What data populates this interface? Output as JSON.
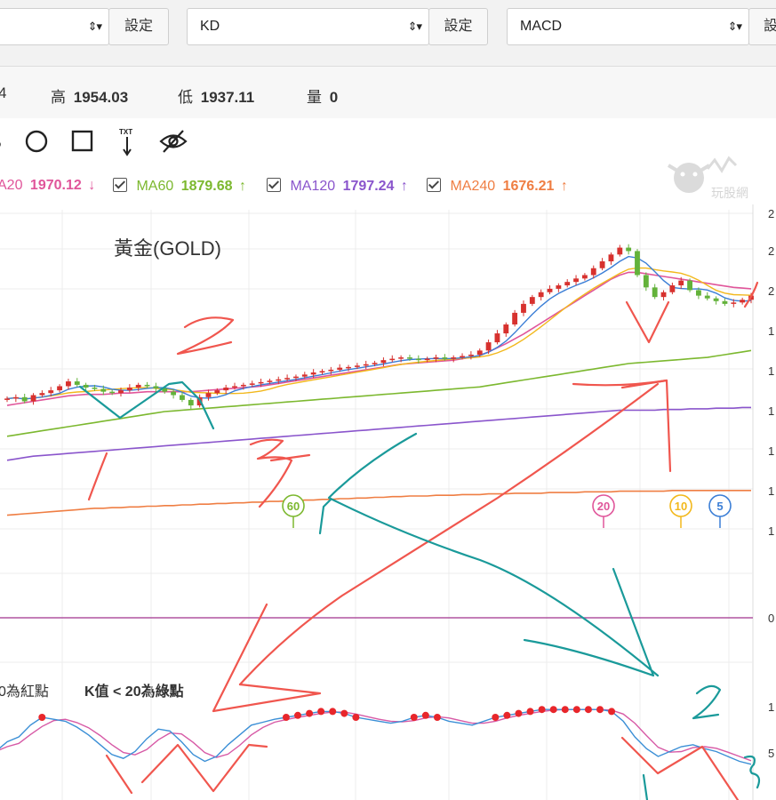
{
  "toolbar": {
    "select1_label": "",
    "set1_label": "設定",
    "select2_label": "KD",
    "set2_label": "設定",
    "select3_label": "MACD",
    "set3_label": "設",
    "arrows": "⇕▾"
  },
  "price_info": {
    "open_partial": "4",
    "high_label": "高",
    "high_value": "1954.03",
    "low_label": "低",
    "low_value": "1937.11",
    "volume_label": "量",
    "volume_value": "0"
  },
  "tools": {
    "items": [
      "candle-tool-icon",
      "circle-tool-icon",
      "rectangle-tool-icon",
      "text-tool-icon",
      "hide-drawings-icon"
    ],
    "text_tool_label": "TXT"
  },
  "ma_legend": [
    {
      "label": "A20",
      "value": "1970.12",
      "arrow": "↓",
      "color": "#e0559a"
    },
    {
      "label": "MA60",
      "value": "1879.68",
      "arrow": "↑",
      "color": "#7cb82f"
    },
    {
      "label": "MA120",
      "value": "1797.24",
      "arrow": "↑",
      "color": "#8a55cc"
    },
    {
      "label": "MA240",
      "value": "1676.21",
      "arrow": "↑",
      "color": "#ef7e43"
    }
  ],
  "watermark": "玩股網",
  "kd_note": {
    "left": "0為紅點",
    "right": "K值 < 20為綠點"
  },
  "colors": {
    "up_candle": "#d7312e",
    "down_candle": "#63b23a",
    "ma5": "#3b7ed6",
    "ma10": "#f2b81c",
    "ma20": "#e0559a",
    "ma60": "#7cb82f",
    "ma120": "#8a55cc",
    "ma240": "#ef7e43",
    "macd_zero": "#b054a0",
    "kd_k": "#3b8fd6",
    "kd_d": "#d75aa6",
    "kd_dot": "#e8262b",
    "annotation_red": "#f0564e",
    "annotation_teal": "#1a9a9a"
  },
  "chart_data": {
    "type": "line",
    "title": "黃金(GOLD)",
    "y_tick_labels_partial": [
      "2",
      "2",
      "2",
      "1",
      "1",
      "1",
      "1",
      "1",
      "1"
    ],
    "macd_zero_label": "0",
    "kd_tick_labels_partial": [
      "1",
      "5"
    ],
    "period_markers": [
      {
        "label": "60",
        "color": "#7cb82f"
      },
      {
        "label": "20",
        "color": "#e0559a"
      },
      {
        "label": "10",
        "color": "#f2b81c"
      },
      {
        "label": "5",
        "color": "#3b7ed6"
      }
    ],
    "approx_price_range": [
      1620,
      2080
    ],
    "close_prices": [
      1810,
      1812,
      1806,
      1815,
      1818,
      1822,
      1828,
      1835,
      1830,
      1826,
      1824,
      1820,
      1818,
      1822,
      1826,
      1830,
      1828,
      1825,
      1820,
      1815,
      1808,
      1800,
      1812,
      1818,
      1822,
      1826,
      1828,
      1830,
      1832,
      1834,
      1836,
      1838,
      1840,
      1842,
      1845,
      1848,
      1850,
      1852,
      1855,
      1856,
      1858,
      1860,
      1862,
      1866,
      1868,
      1870,
      1868,
      1866,
      1868,
      1870,
      1868,
      1870,
      1872,
      1874,
      1880,
      1892,
      1905,
      1918,
      1935,
      1948,
      1958,
      1965,
      1970,
      1975,
      1980,
      1985,
      1990,
      2000,
      2010,
      2020,
      2030,
      2025,
      1990,
      1972,
      1958,
      1965,
      1975,
      1982,
      1968,
      1960,
      1956,
      1952,
      1948,
      1950,
      1954,
      1960
    ],
    "series": [
      {
        "name": "MA20",
        "values": [
          1800,
          1802,
          1804,
          1806,
          1808,
          1810,
          1812,
          1814,
          1815,
          1816,
          1816,
          1816,
          1817,
          1818,
          1818,
          1819,
          1820,
          1820,
          1820,
          1820,
          1820,
          1820,
          1821,
          1822,
          1823,
          1824,
          1825,
          1826,
          1827,
          1828,
          1830,
          1832,
          1834,
          1836,
          1838,
          1840,
          1842,
          1844,
          1846,
          1848,
          1850,
          1852,
          1854,
          1856,
          1858,
          1860,
          1861,
          1862,
          1863,
          1864,
          1865,
          1866,
          1868,
          1870,
          1873,
          1878,
          1884,
          1890,
          1897,
          1904,
          1912,
          1920,
          1928,
          1936,
          1944,
          1952,
          1960,
          1968,
          1976,
          1984,
          1990,
          1994,
          1994,
          1992,
          1990,
          1988,
          1986,
          1984,
          1982,
          1980,
          1978,
          1976,
          1974,
          1972,
          1971,
          1970
        ]
      },
      {
        "name": "MA60",
        "values": [
          1755,
          1757,
          1759,
          1761,
          1763,
          1765,
          1767,
          1769,
          1771,
          1773,
          1775,
          1777,
          1779,
          1781,
          1783,
          1785,
          1787,
          1789,
          1791,
          1792,
          1793,
          1794,
          1795,
          1796,
          1797,
          1798,
          1799,
          1800,
          1801,
          1802,
          1803,
          1804,
          1805,
          1806,
          1807,
          1808,
          1809,
          1810,
          1811,
          1812,
          1813,
          1814,
          1815,
          1816,
          1817,
          1818,
          1819,
          1820,
          1821,
          1822,
          1823,
          1824,
          1825,
          1826,
          1827,
          1829,
          1831,
          1833,
          1835,
          1837,
          1839,
          1841,
          1843,
          1845,
          1847,
          1849,
          1851,
          1853,
          1855,
          1857,
          1859,
          1861,
          1862,
          1863,
          1864,
          1865,
          1866,
          1867,
          1868,
          1869,
          1870,
          1872,
          1874,
          1876,
          1878,
          1880
        ]
      },
      {
        "name": "MA120",
        "values": [
          1720,
          1722,
          1724,
          1726,
          1727,
          1728,
          1729,
          1730,
          1731,
          1732,
          1733,
          1734,
          1735,
          1736,
          1737,
          1738,
          1739,
          1740,
          1741,
          1742,
          1743,
          1744,
          1745,
          1746,
          1747,
          1748,
          1749,
          1750,
          1751,
          1752,
          1753,
          1754,
          1755,
          1756,
          1757,
          1758,
          1759,
          1760,
          1761,
          1762,
          1763,
          1764,
          1765,
          1766,
          1767,
          1768,
          1769,
          1770,
          1771,
          1772,
          1773,
          1774,
          1775,
          1776,
          1777,
          1778,
          1779,
          1780,
          1781,
          1782,
          1783,
          1784,
          1785,
          1786,
          1787,
          1788,
          1789,
          1790,
          1791,
          1792,
          1793,
          1793,
          1793,
          1793,
          1793,
          1794,
          1794,
          1794,
          1795,
          1795,
          1795,
          1796,
          1796,
          1796,
          1797,
          1797
        ]
      },
      {
        "name": "MA240",
        "values": [
          1640,
          1641,
          1642,
          1643,
          1644,
          1645,
          1646,
          1647,
          1648,
          1649,
          1650,
          1650,
          1651,
          1651,
          1652,
          1652,
          1653,
          1653,
          1654,
          1654,
          1655,
          1655,
          1656,
          1656,
          1657,
          1657,
          1658,
          1658,
          1659,
          1659,
          1660,
          1660,
          1661,
          1661,
          1662,
          1662,
          1663,
          1663,
          1664,
          1664,
          1665,
          1665,
          1666,
          1666,
          1667,
          1667,
          1668,
          1668,
          1668,
          1669,
          1669,
          1669,
          1670,
          1670,
          1670,
          1671,
          1671,
          1671,
          1672,
          1672,
          1672,
          1672,
          1673,
          1673,
          1673,
          1673,
          1674,
          1674,
          1674,
          1674,
          1675,
          1675,
          1675,
          1675,
          1675,
          1675,
          1676,
          1676,
          1676,
          1676,
          1676,
          1676,
          1676,
          1676,
          1676,
          1676
        ]
      }
    ],
    "kd_k_values": [
      45,
      55,
      60,
      72,
      80,
      78,
      76,
      70,
      62,
      52,
      42,
      38,
      45,
      58,
      68,
      66,
      55,
      42,
      35,
      40,
      52,
      62,
      72,
      75,
      78,
      80,
      82,
      84,
      86,
      86,
      84,
      80,
      78,
      76,
      74,
      76,
      80,
      82,
      80,
      76,
      74,
      72,
      76,
      80,
      82,
      84,
      86,
      88,
      88,
      88,
      88,
      88,
      88,
      86,
      76,
      60,
      48,
      40,
      45,
      50,
      52,
      48,
      45,
      40,
      35,
      32
    ]
  }
}
